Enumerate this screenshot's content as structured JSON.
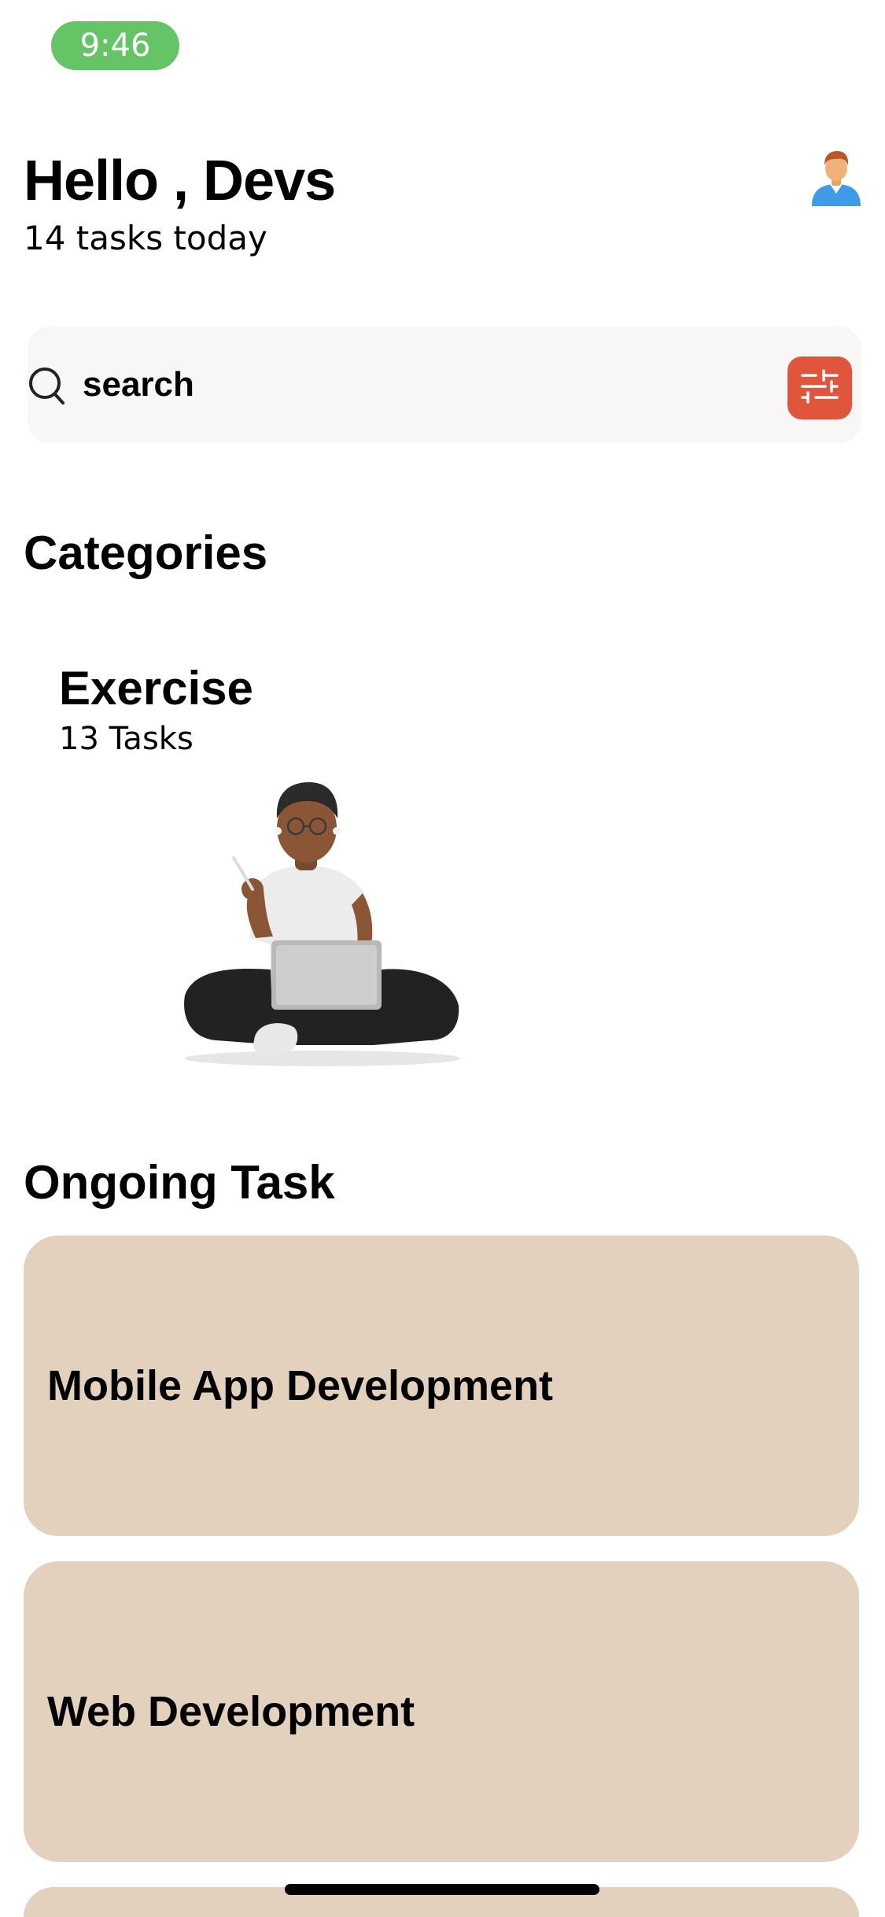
{
  "status_bar": {
    "time": "9:46",
    "pill_color": "#65c466"
  },
  "header": {
    "greeting": "Hello , Devs",
    "subtitle": "14 tasks today",
    "avatar_icon": "person-avatar-icon"
  },
  "search": {
    "placeholder": "search",
    "value": "",
    "icon": "search-icon",
    "filter_icon": "sliders-icon",
    "filter_color": "#e0553c"
  },
  "categories": {
    "title": "Categories",
    "items": [
      {
        "title": "Exercise",
        "count": "13 Tasks",
        "illustration": "person-with-laptop-illustration"
      }
    ]
  },
  "ongoing": {
    "title": "Ongoing Task",
    "card_color": "#e3d1bd",
    "tasks": [
      {
        "title": "Mobile App Development"
      },
      {
        "title": "Web Development"
      }
    ]
  }
}
